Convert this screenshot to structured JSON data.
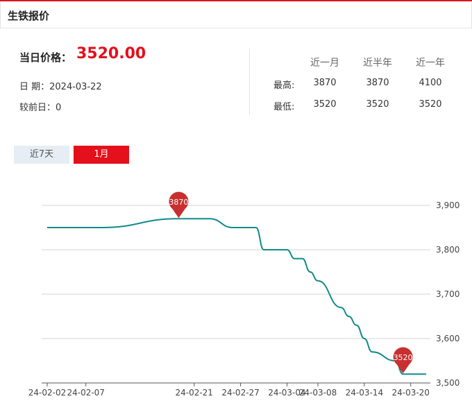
{
  "header": {
    "title": "生铁报价"
  },
  "summary": {
    "price_label": "当日价格：",
    "price_value": "3520.00",
    "date_line": "日 期：2024-03-22",
    "change_line": "较前日：0"
  },
  "stats": {
    "columns": [
      "近一月",
      "近半年",
      "近一年"
    ],
    "rows": [
      {
        "label": "最高:",
        "values": [
          "3870",
          "3870",
          "4100"
        ]
      },
      {
        "label": "最低:",
        "values": [
          "3520",
          "3520",
          "3520"
        ]
      }
    ]
  },
  "tabs": [
    {
      "label": "近7天",
      "active": false
    },
    {
      "label": "1月",
      "active": true
    }
  ],
  "colors": {
    "accent": "#e4101b",
    "line": "#108a8a",
    "marker": "#c8302f"
  },
  "chart_data": {
    "type": "line",
    "ylim": [
      3500,
      3900
    ],
    "yticks": [
      3500,
      3600,
      3700,
      3800,
      3900
    ],
    "ytick_labels": [
      "3,500",
      "3,600",
      "3,700",
      "3,800",
      "3,900"
    ],
    "xlim": [
      "2024-02-02",
      "2024-03-22"
    ],
    "xticks": [
      "2024-02-02",
      "2024-02-07",
      "2024-02-21",
      "2024-02-27",
      "2024-03-04",
      "2024-03-08",
      "2024-03-14",
      "2024-03-20"
    ],
    "xtick_labels": [
      "24-02-02",
      "24-02-07",
      "24-02-21",
      "24-02-27",
      "24-03-04",
      "24-03-08",
      "24-03-14",
      "24-03-20"
    ],
    "grid": true,
    "series": [
      {
        "points": [
          [
            "2024-02-02",
            3850
          ],
          [
            "2024-02-07",
            3850
          ],
          [
            "2024-02-08",
            3850
          ],
          [
            "2024-02-09",
            3850
          ],
          [
            "2024-02-19",
            3870
          ],
          [
            "2024-02-20",
            3870
          ],
          [
            "2024-02-21",
            3870
          ],
          [
            "2024-02-22",
            3870
          ],
          [
            "2024-02-23",
            3870
          ],
          [
            "2024-02-26",
            3850
          ],
          [
            "2024-02-27",
            3850
          ],
          [
            "2024-02-28",
            3850
          ],
          [
            "2024-02-29",
            3850
          ],
          [
            "2024-03-01",
            3800
          ],
          [
            "2024-03-04",
            3800
          ],
          [
            "2024-03-05",
            3780
          ],
          [
            "2024-03-06",
            3780
          ],
          [
            "2024-03-07",
            3750
          ],
          [
            "2024-03-08",
            3730
          ],
          [
            "2024-03-11",
            3670
          ],
          [
            "2024-03-12",
            3650
          ],
          [
            "2024-03-13",
            3630
          ],
          [
            "2024-03-14",
            3600
          ],
          [
            "2024-03-15",
            3570
          ],
          [
            "2024-03-18",
            3550
          ],
          [
            "2024-03-19",
            3520
          ],
          [
            "2024-03-20",
            3520
          ],
          [
            "2024-03-21",
            3520
          ],
          [
            "2024-03-22",
            3520
          ]
        ]
      }
    ],
    "annotations": [
      {
        "x": "2024-02-19",
        "y": 3870,
        "label": "3870"
      },
      {
        "x": "2024-03-19",
        "y": 3520,
        "label": "3520"
      }
    ]
  }
}
